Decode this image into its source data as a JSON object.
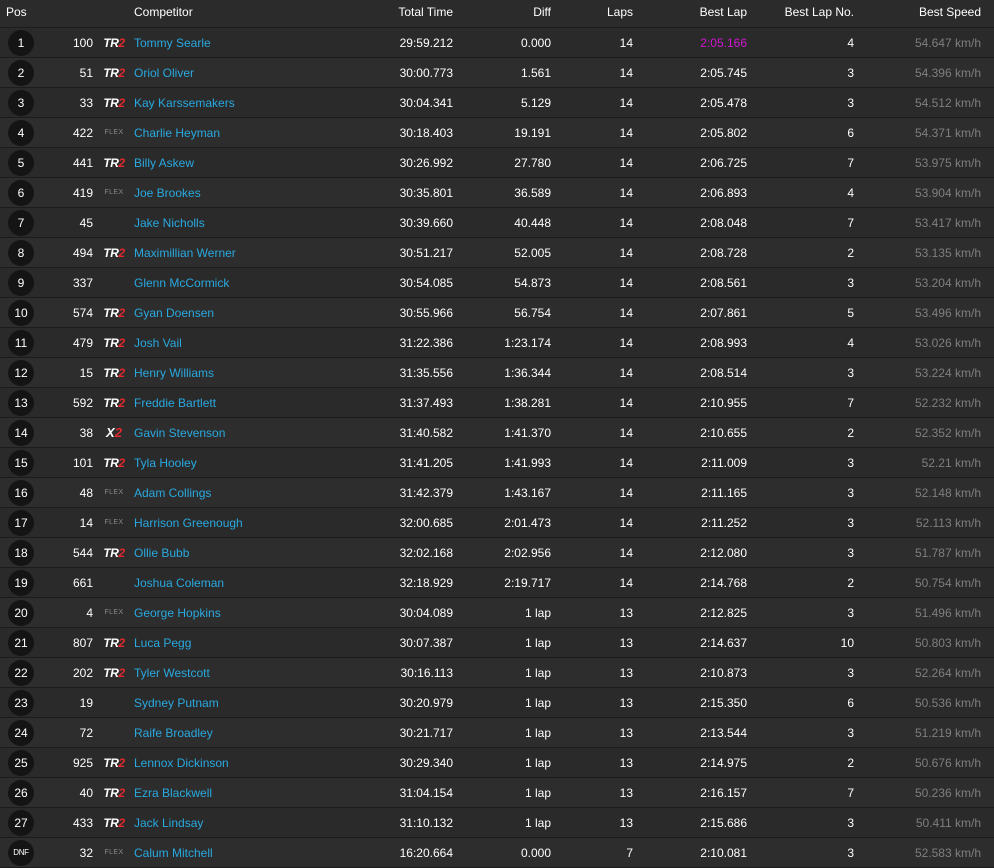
{
  "headers": {
    "pos": "Pos",
    "competitor": "Competitor",
    "total_time": "Total Time",
    "diff": "Diff",
    "laps": "Laps",
    "best_lap": "Best Lap",
    "best_lap_no": "Best Lap No.",
    "best_speed": "Best Speed"
  },
  "logos": {
    "tr2_prefix": "TR",
    "x2_prefix": "X",
    "suffix_two": "2",
    "flex": "FLEX"
  },
  "rows": [
    {
      "pos": "1",
      "num": "100",
      "logo": "tr2",
      "name": "Tommy Searle",
      "total": "29:59.212",
      "diff": "0.000",
      "laps": "14",
      "best": "2:05.166",
      "fastest": true,
      "best_no": "4",
      "speed": "54.647 km/h"
    },
    {
      "pos": "2",
      "num": "51",
      "logo": "tr2",
      "name": "Oriol Oliver",
      "total": "30:00.773",
      "diff": "1.561",
      "laps": "14",
      "best": "2:05.745",
      "best_no": "3",
      "speed": "54.396 km/h"
    },
    {
      "pos": "3",
      "num": "33",
      "logo": "tr2",
      "name": "Kay Karssemakers",
      "total": "30:04.341",
      "diff": "5.129",
      "laps": "14",
      "best": "2:05.478",
      "best_no": "3",
      "speed": "54.512 km/h"
    },
    {
      "pos": "4",
      "num": "422",
      "logo": "flex",
      "name": "Charlie Heyman",
      "total": "30:18.403",
      "diff": "19.191",
      "laps": "14",
      "best": "2:05.802",
      "best_no": "6",
      "speed": "54.371 km/h"
    },
    {
      "pos": "5",
      "num": "441",
      "logo": "tr2",
      "name": "Billy Askew",
      "total": "30:26.992",
      "diff": "27.780",
      "laps": "14",
      "best": "2:06.725",
      "best_no": "7",
      "speed": "53.975 km/h"
    },
    {
      "pos": "6",
      "num": "419",
      "logo": "flex",
      "name": "Joe Brookes",
      "total": "30:35.801",
      "diff": "36.589",
      "laps": "14",
      "best": "2:06.893",
      "best_no": "4",
      "speed": "53.904 km/h"
    },
    {
      "pos": "7",
      "num": "45",
      "logo": "",
      "name": "Jake Nicholls",
      "total": "30:39.660",
      "diff": "40.448",
      "laps": "14",
      "best": "2:08.048",
      "best_no": "7",
      "speed": "53.417 km/h"
    },
    {
      "pos": "8",
      "num": "494",
      "logo": "tr2",
      "name": "Maximillian Werner",
      "total": "30:51.217",
      "diff": "52.005",
      "laps": "14",
      "best": "2:08.728",
      "best_no": "2",
      "speed": "53.135 km/h"
    },
    {
      "pos": "9",
      "num": "337",
      "logo": "",
      "name": "Glenn McCormick",
      "total": "30:54.085",
      "diff": "54.873",
      "laps": "14",
      "best": "2:08.561",
      "best_no": "3",
      "speed": "53.204 km/h"
    },
    {
      "pos": "10",
      "num": "574",
      "logo": "tr2",
      "name": "Gyan Doensen",
      "total": "30:55.966",
      "diff": "56.754",
      "laps": "14",
      "best": "2:07.861",
      "best_no": "5",
      "speed": "53.496 km/h"
    },
    {
      "pos": "11",
      "num": "479",
      "logo": "tr2",
      "name": "Josh Vail",
      "total": "31:22.386",
      "diff": "1:23.174",
      "laps": "14",
      "best": "2:08.993",
      "best_no": "4",
      "speed": "53.026 km/h"
    },
    {
      "pos": "12",
      "num": "15",
      "logo": "tr2",
      "name": "Henry Williams",
      "total": "31:35.556",
      "diff": "1:36.344",
      "laps": "14",
      "best": "2:08.514",
      "best_no": "3",
      "speed": "53.224 km/h"
    },
    {
      "pos": "13",
      "num": "592",
      "logo": "tr2",
      "name": "Freddie Bartlett",
      "total": "31:37.493",
      "diff": "1:38.281",
      "laps": "14",
      "best": "2:10.955",
      "best_no": "7",
      "speed": "52.232 km/h"
    },
    {
      "pos": "14",
      "num": "38",
      "logo": "x2",
      "name": "Gavin Stevenson",
      "total": "31:40.582",
      "diff": "1:41.370",
      "laps": "14",
      "best": "2:10.655",
      "best_no": "2",
      "speed": "52.352 km/h"
    },
    {
      "pos": "15",
      "num": "101",
      "logo": "tr2",
      "name": "Tyla Hooley",
      "total": "31:41.205",
      "diff": "1:41.993",
      "laps": "14",
      "best": "2:11.009",
      "best_no": "3",
      "speed": "52.21 km/h"
    },
    {
      "pos": "16",
      "num": "48",
      "logo": "flex",
      "name": "Adam Collings",
      "total": "31:42.379",
      "diff": "1:43.167",
      "laps": "14",
      "best": "2:11.165",
      "best_no": "3",
      "speed": "52.148 km/h"
    },
    {
      "pos": "17",
      "num": "14",
      "logo": "flex",
      "name": "Harrison Greenough",
      "total": "32:00.685",
      "diff": "2:01.473",
      "laps": "14",
      "best": "2:11.252",
      "best_no": "3",
      "speed": "52.113 km/h"
    },
    {
      "pos": "18",
      "num": "544",
      "logo": "tr2",
      "name": "Ollie Bubb",
      "total": "32:02.168",
      "diff": "2:02.956",
      "laps": "14",
      "best": "2:12.080",
      "best_no": "3",
      "speed": "51.787 km/h"
    },
    {
      "pos": "19",
      "num": "661",
      "logo": "",
      "name": "Joshua Coleman",
      "total": "32:18.929",
      "diff": "2:19.717",
      "laps": "14",
      "best": "2:14.768",
      "best_no": "2",
      "speed": "50.754 km/h"
    },
    {
      "pos": "20",
      "num": "4",
      "logo": "flex",
      "name": "George Hopkins",
      "total": "30:04.089",
      "diff": "1 lap",
      "laps": "13",
      "best": "2:12.825",
      "best_no": "3",
      "speed": "51.496 km/h"
    },
    {
      "pos": "21",
      "num": "807",
      "logo": "tr2",
      "name": "Luca Pegg",
      "total": "30:07.387",
      "diff": "1 lap",
      "laps": "13",
      "best": "2:14.637",
      "best_no": "10",
      "speed": "50.803 km/h"
    },
    {
      "pos": "22",
      "num": "202",
      "logo": "tr2",
      "name": "Tyler Westcott",
      "total": "30:16.113",
      "diff": "1 lap",
      "laps": "13",
      "best": "2:10.873",
      "best_no": "3",
      "speed": "52.264 km/h"
    },
    {
      "pos": "23",
      "num": "19",
      "logo": "",
      "name": "Sydney Putnam",
      "total": "30:20.979",
      "diff": "1 lap",
      "laps": "13",
      "best": "2:15.350",
      "best_no": "6",
      "speed": "50.536 km/h"
    },
    {
      "pos": "24",
      "num": "72",
      "logo": "",
      "name": "Raife Broadley",
      "total": "30:21.717",
      "diff": "1 lap",
      "laps": "13",
      "best": "2:13.544",
      "best_no": "3",
      "speed": "51.219 km/h"
    },
    {
      "pos": "25",
      "num": "925",
      "logo": "tr2",
      "name": "Lennox Dickinson",
      "total": "30:29.340",
      "diff": "1 lap",
      "laps": "13",
      "best": "2:14.975",
      "best_no": "2",
      "speed": "50.676 km/h"
    },
    {
      "pos": "26",
      "num": "40",
      "logo": "tr2",
      "name": "Ezra Blackwell",
      "total": "31:04.154",
      "diff": "1 lap",
      "laps": "13",
      "best": "2:16.157",
      "best_no": "7",
      "speed": "50.236 km/h"
    },
    {
      "pos": "27",
      "num": "433",
      "logo": "tr2",
      "name": "Jack Lindsay",
      "total": "31:10.132",
      "diff": "1 lap",
      "laps": "13",
      "best": "2:15.686",
      "best_no": "3",
      "speed": "50.411 km/h"
    },
    {
      "pos": "DNF",
      "num": "32",
      "logo": "flex",
      "name": "Calum Mitchell",
      "total": "16:20.664",
      "diff": "0.000",
      "laps": "7",
      "best": "2:10.081",
      "best_no": "3",
      "speed": "52.583 km/h"
    }
  ]
}
